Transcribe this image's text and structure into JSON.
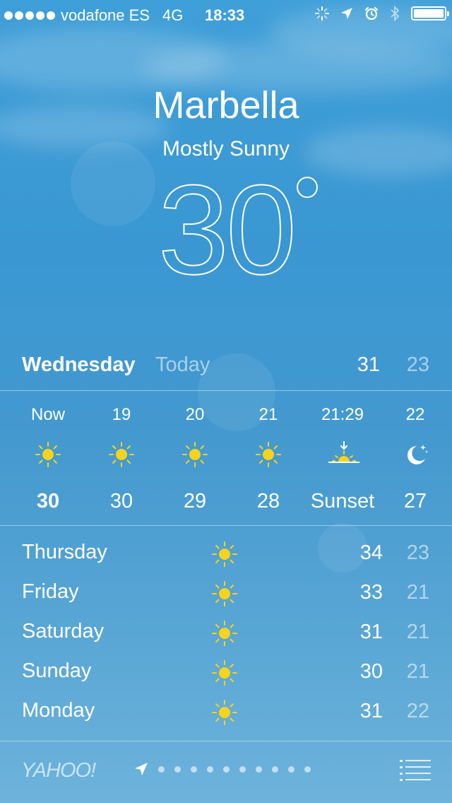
{
  "status_bar": {
    "carrier": "vodafone ES",
    "network": "4G",
    "time": "18:33"
  },
  "weather": {
    "city": "Marbella",
    "condition": "Mostly Sunny",
    "temperature": "30",
    "today": {
      "day": "Wednesday",
      "label": "Today",
      "high": "31",
      "low": "23"
    },
    "hourly": [
      {
        "time": "Now",
        "icon": "sun-icon",
        "temp": "30"
      },
      {
        "time": "19",
        "icon": "sun-icon",
        "temp": "30"
      },
      {
        "time": "20",
        "icon": "sun-icon",
        "temp": "29"
      },
      {
        "time": "21",
        "icon": "sun-icon",
        "temp": "28"
      },
      {
        "time": "21:29",
        "icon": "sunset-icon",
        "temp": "Sunset"
      },
      {
        "time": "22",
        "icon": "moon-icon",
        "temp": "27"
      }
    ],
    "forecast": [
      {
        "day": "Thursday",
        "icon": "sun-icon",
        "high": "34",
        "low": "23"
      },
      {
        "day": "Friday",
        "icon": "sun-icon",
        "high": "33",
        "low": "21"
      },
      {
        "day": "Saturday",
        "icon": "sun-icon",
        "high": "31",
        "low": "21"
      },
      {
        "day": "Sunday",
        "icon": "sun-icon",
        "high": "30",
        "low": "21"
      },
      {
        "day": "Monday",
        "icon": "sun-icon",
        "high": "31",
        "low": "22"
      }
    ]
  },
  "footer": {
    "brand": "YAHOO!",
    "page_count": 10
  },
  "colors": {
    "sun": "#f7d31c",
    "sky_top": "#3f9fd8",
    "sky_bottom": "#6db3dc"
  }
}
